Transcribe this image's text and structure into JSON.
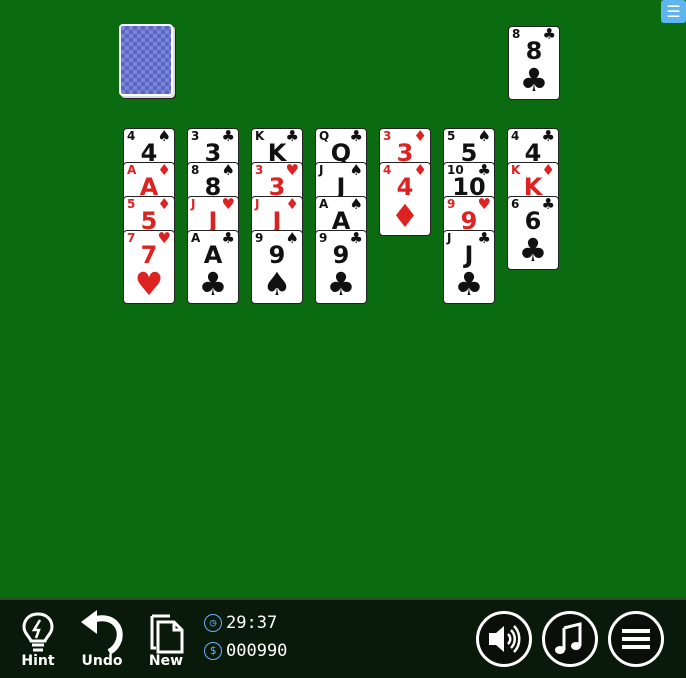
{
  "table": {
    "background_color": "#0b6b10"
  },
  "stock": {
    "label": ""
  },
  "waste": [
    {
      "rank": "8",
      "suit": "♣",
      "color": "black"
    }
  ],
  "tableau": [
    [
      {
        "rank": "4",
        "suit": "♠",
        "color": "black"
      },
      {
        "rank": "A",
        "suit": "♦",
        "color": "red"
      },
      {
        "rank": "5",
        "suit": "♦",
        "color": "red"
      },
      {
        "rank": "7",
        "suit": "♥",
        "color": "red"
      }
    ],
    [
      {
        "rank": "3",
        "suit": "♣",
        "color": "black"
      },
      {
        "rank": "8",
        "suit": "♠",
        "color": "black"
      },
      {
        "rank": "J",
        "suit": "♥",
        "color": "red"
      },
      {
        "rank": "A",
        "suit": "♣",
        "color": "black"
      }
    ],
    [
      {
        "rank": "K",
        "suit": "♣",
        "color": "black"
      },
      {
        "rank": "3",
        "suit": "♥",
        "color": "red"
      },
      {
        "rank": "J",
        "suit": "♦",
        "color": "red"
      },
      {
        "rank": "9",
        "suit": "♠",
        "color": "black"
      }
    ],
    [
      {
        "rank": "Q",
        "suit": "♣",
        "color": "black"
      },
      {
        "rank": "J",
        "suit": "♠",
        "color": "black"
      },
      {
        "rank": "A",
        "suit": "♠",
        "color": "black"
      },
      {
        "rank": "9",
        "suit": "♣",
        "color": "black"
      }
    ],
    [
      {
        "rank": "3",
        "suit": "♦",
        "color": "red"
      },
      {
        "rank": "4",
        "suit": "♦",
        "color": "red"
      }
    ],
    [
      {
        "rank": "5",
        "suit": "♠",
        "color": "black"
      },
      {
        "rank": "10",
        "suit": "♣",
        "color": "black"
      },
      {
        "rank": "9",
        "suit": "♥",
        "color": "red"
      },
      {
        "rank": "J",
        "suit": "♣",
        "color": "black"
      }
    ],
    [
      {
        "rank": "4",
        "suit": "♣",
        "color": "black"
      },
      {
        "rank": "K",
        "suit": "♦",
        "color": "red"
      },
      {
        "rank": "6",
        "suit": "♣",
        "color": "black"
      }
    ]
  ],
  "toolbar": {
    "hint_label": "Hint",
    "undo_label": "Undo",
    "new_label": "New",
    "timer": "29:37",
    "score": "000990",
    "timer_icon": "clock-icon",
    "score_icon": "dollar-icon"
  },
  "controls": {
    "sound_icon": "speaker-icon",
    "music_icon": "music-note-icon",
    "menu_icon": "hamburger-menu-icon",
    "corner_menu_icon": "hamburger-menu-icon"
  }
}
